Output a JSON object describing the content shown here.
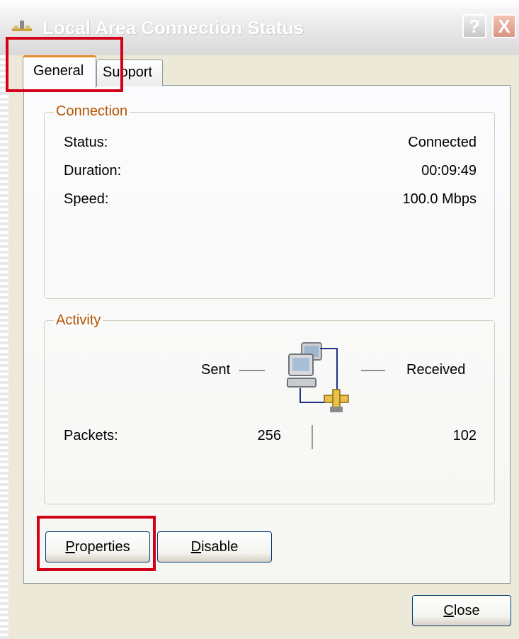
{
  "window": {
    "title": "Local Area Connection Status",
    "help_label": "?",
    "close_label": "X"
  },
  "tabs": [
    {
      "label": "General",
      "selected": true
    },
    {
      "label": "Support",
      "selected": false
    }
  ],
  "connection": {
    "group_label": "Connection",
    "rows": [
      {
        "label": "Status:",
        "value": "Connected"
      },
      {
        "label": "Duration:",
        "value": "00:09:49"
      },
      {
        "label": "Speed:",
        "value": "100.0 Mbps"
      }
    ]
  },
  "activity": {
    "group_label": "Activity",
    "sent_label": "Sent",
    "received_label": "Received",
    "packets_label": "Packets:",
    "packets_sent": "256",
    "packets_received": "102"
  },
  "buttons": {
    "properties": {
      "prefix": "",
      "accel": "P",
      "rest": "roperties"
    },
    "disable": {
      "prefix": "",
      "accel": "D",
      "rest": "isable"
    },
    "close": {
      "prefix": "",
      "accel": "C",
      "rest": "lose"
    }
  },
  "icons": {
    "title_icon": "network-connection-icon",
    "activity_icon": "network-computers-icon"
  },
  "colors": {
    "highlight": "#d4001a",
    "tab_accent": "#e68b2c",
    "groupbox_label": "#b45300"
  }
}
